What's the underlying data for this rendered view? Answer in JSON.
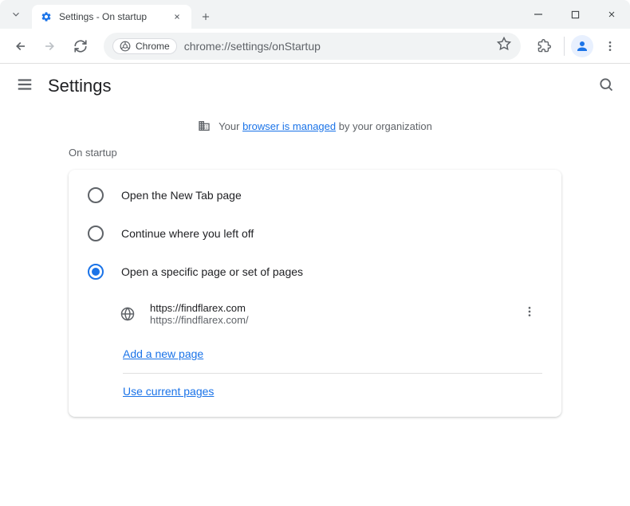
{
  "tab": {
    "title": "Settings - On startup"
  },
  "omnibox": {
    "chip": "Chrome",
    "url": "chrome://settings/onStartup"
  },
  "settings": {
    "title": "Settings",
    "managed_prefix": "Your",
    "managed_link": "browser is managed",
    "managed_suffix": "by your organization"
  },
  "startup": {
    "section_title": "On startup",
    "options": [
      {
        "label": "Open the New Tab page"
      },
      {
        "label": "Continue where you left off"
      },
      {
        "label": "Open a specific page or set of pages"
      }
    ],
    "page": {
      "title": "https://findflarex.com",
      "url": "https://findflarex.com/"
    },
    "add_new_page": "Add a new page",
    "use_current": "Use current pages"
  }
}
